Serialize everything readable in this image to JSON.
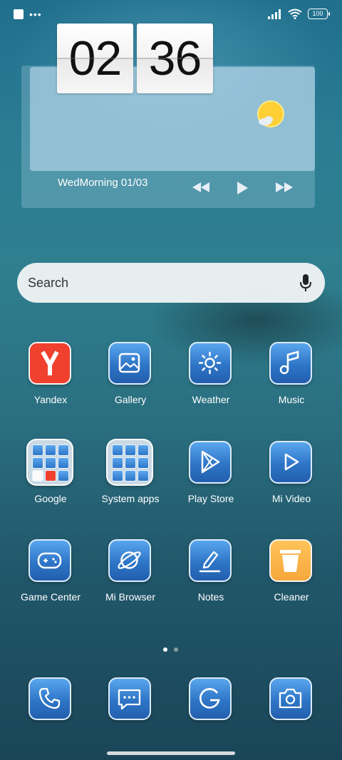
{
  "status_bar": {
    "dots": "•••",
    "battery": "100"
  },
  "widget": {
    "hour": "02",
    "minute": "36",
    "date_text": "WedMorning 01/03",
    "weather_icon": "sun-cloud-icon",
    "media_controls": [
      "previous-icon",
      "play-icon",
      "next-icon"
    ]
  },
  "search": {
    "placeholder": "Search",
    "icon": "microphone-icon"
  },
  "apps": [
    {
      "label": "Yandex",
      "icon": "yandex-icon"
    },
    {
      "label": "Gallery",
      "icon": "gallery-icon"
    },
    {
      "label": "Weather",
      "icon": "weather-sun-icon"
    },
    {
      "label": "Music",
      "icon": "music-note-icon"
    },
    {
      "label": "Google",
      "icon": "folder-icon"
    },
    {
      "label": "System apps",
      "icon": "folder-icon"
    },
    {
      "label": "Play Store",
      "icon": "play-store-icon"
    },
    {
      "label": "Mi Video",
      "icon": "video-play-icon"
    },
    {
      "label": "Game Center",
      "icon": "gamepad-icon"
    },
    {
      "label": "Mi Browser",
      "icon": "browser-planet-icon"
    },
    {
      "label": "Notes",
      "icon": "pencil-icon"
    },
    {
      "label": "Cleaner",
      "icon": "trash-icon"
    }
  ],
  "dock": [
    {
      "icon": "phone-icon"
    },
    {
      "icon": "messages-icon"
    },
    {
      "icon": "google-g-icon"
    },
    {
      "icon": "camera-icon"
    }
  ],
  "page_indicator": {
    "count": 2,
    "active": 1
  },
  "colors": {
    "icon_blue": "#2e75c7",
    "yandex_red": "#f0402e",
    "cleaner_orange": "#f6a73c"
  }
}
